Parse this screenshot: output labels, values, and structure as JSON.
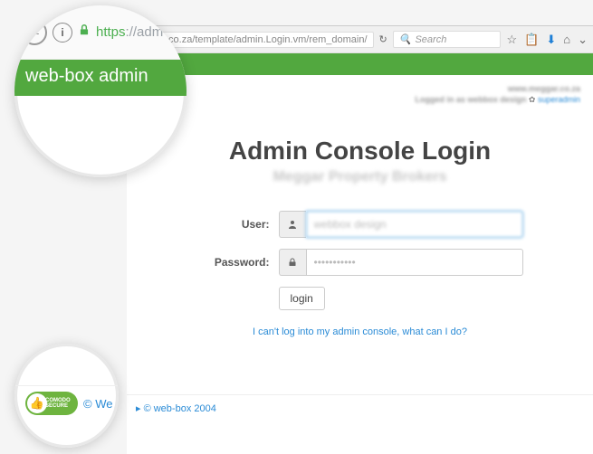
{
  "chrome": {
    "url_fragment": "ebbox.co.za/template/admin.Login.vm/rem_domain/",
    "search_placeholder": "Search"
  },
  "magnifier_top": {
    "url_prefix_scheme": "https",
    "url_prefix_rest": "://adm",
    "green_header": "web-box admin"
  },
  "status": {
    "domain": "www.meggar.co.za",
    "logged_in": "Logged in as webbox design",
    "superadmin": "superadmin"
  },
  "main": {
    "title": "Admin Console Login",
    "subtitle": "Meggar Property Brokers",
    "user_label": "User:",
    "user_value": "webbox design",
    "password_label": "Password:",
    "password_value": "•••••••••••",
    "login_label": "login",
    "help_link": "I can't log into my admin console, what can I do?"
  },
  "footer": {
    "copyright": "© web-box 2004"
  },
  "magnifier_bottom": {
    "badge_top": "COMODO",
    "badge_bottom": "SECURE",
    "copy_fragment": "© We"
  }
}
